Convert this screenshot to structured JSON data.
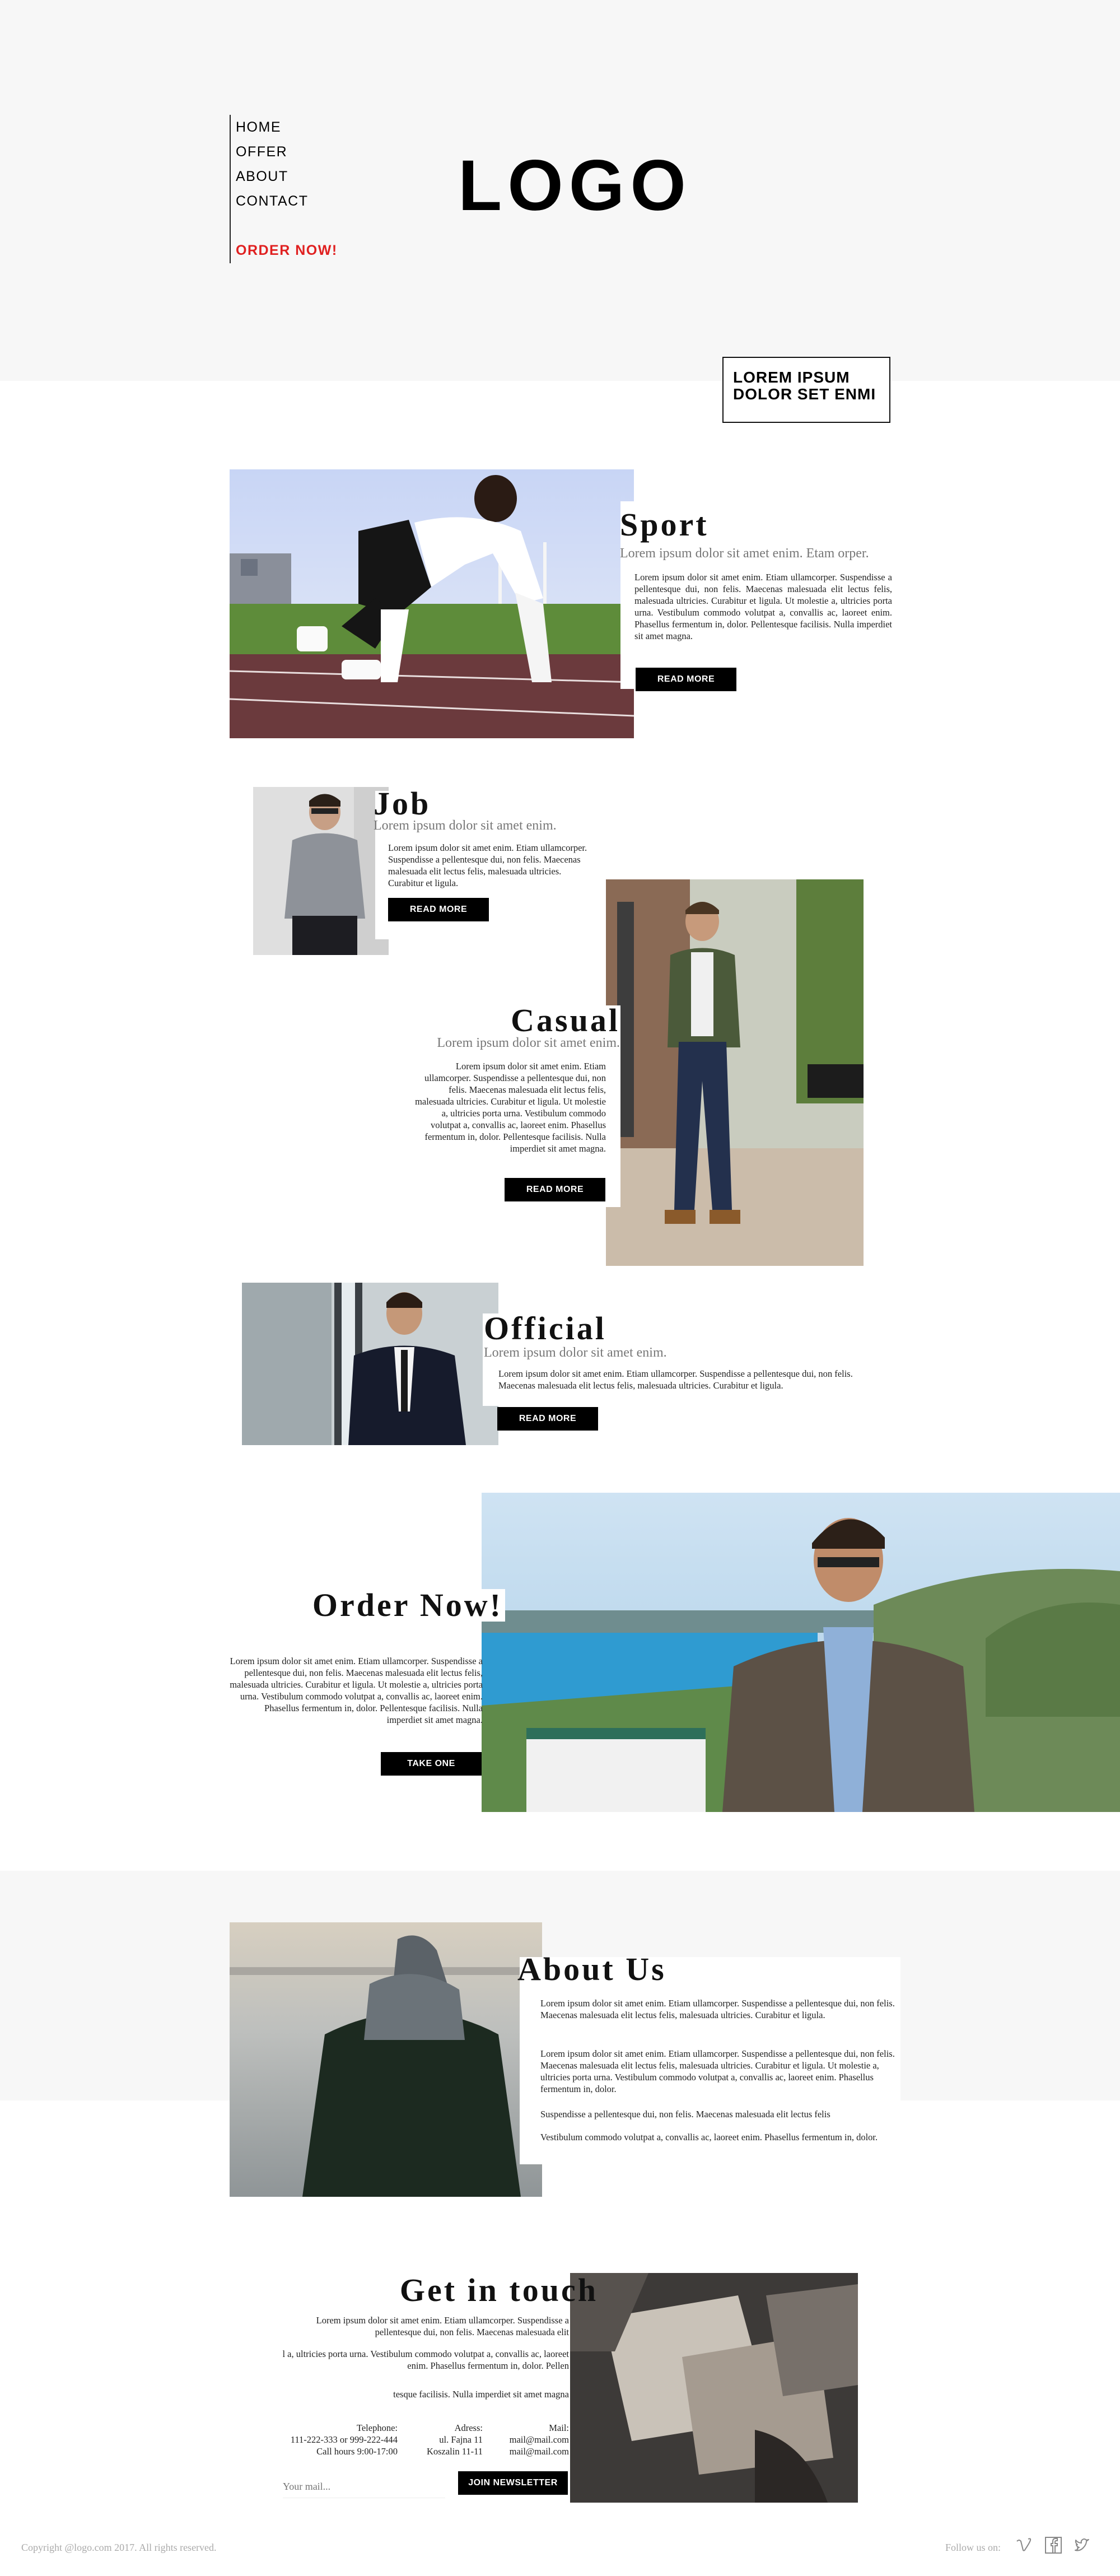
{
  "nav": {
    "items": [
      "HOME",
      "OFFER",
      "ABOUT",
      "CONTACT"
    ],
    "order": "ORDER NOW!"
  },
  "logo": "LOGO",
  "tagline": {
    "line1": "LOREM IPSUM",
    "line2": "DOLOR SET ENMI"
  },
  "sections": {
    "sport": {
      "title": "Sport",
      "subtitle": "Lorem ipsum dolor sit amet enim. Etam orper.",
      "body": "Lorem ipsum dolor sit amet enim. Etiam ullamcorper. Suspendisse a pellentesque dui, non felis. Maecenas malesuada elit lectus felis, malesuada ultricies. Curabitur et ligula. Ut molestie a, ultricies porta urna. Vestibulum commodo volutpat a, convallis ac, laoreet enim. Phasellus fermentum in, dolor. Pellentesque facilisis. Nulla imperdiet sit amet magna.",
      "button": "READ MORE"
    },
    "job": {
      "title": "Job",
      "subtitle": "Lorem ipsum dolor sit amet enim.",
      "body": "Lorem ipsum dolor sit amet enim. Etiam ullamcorper. Suspendisse a pellentesque dui, non felis. Maecenas malesuada elit lectus felis, malesuada ultricies. Curabitur et ligula.",
      "button": "READ MORE"
    },
    "casual": {
      "title": "Casual",
      "subtitle": "Lorem ipsum dolor sit amet enim.",
      "body": "Lorem ipsum dolor sit amet enim. Etiam ullamcorper. Suspendisse a pellentesque dui, non felis. Maecenas malesuada elit lectus felis, malesuada ultricies. Curabitur et ligula. Ut molestie a, ultricies porta urna. Vestibulum commodo volutpat a, convallis ac, laoreet enim. Phasellus fermentum in, dolor. Pellentesque facilisis. Nulla imperdiet sit amet magna.",
      "button": "READ MORE"
    },
    "official": {
      "title": "Official",
      "subtitle": "Lorem ipsum dolor sit amet enim.",
      "body": "Lorem ipsum dolor sit amet enim. Etiam ullamcorper. Suspendisse a pellentesque dui, non felis. Maecenas malesuada elit lectus felis, malesuada ultricies. Curabitur et ligula.",
      "button": "READ MORE"
    },
    "order": {
      "title": "Order Now!",
      "body": "Lorem ipsum dolor sit amet enim. Etiam ullamcorper. Suspendisse a pellentesque dui, non felis. Maecenas malesuada elit lectus felis, malesuada ultricies. Curabitur et ligula. Ut molestie a, ultricies porta urna. Vestibulum commodo volutpat a, convallis ac, laoreet enim. Phasellus fermentum in, dolor. Pellentesque facilisis. Nulla imperdiet sit amet magna.",
      "button": "TAKE ONE"
    },
    "about": {
      "title": "About Us",
      "p1": "Lorem ipsum dolor sit amet enim. Etiam ullamcorper. Suspendisse a pellentesque dui, non felis. Maecenas malesuada elit lectus felis, malesuada ultricies. Curabitur et ligula.",
      "p2": "Lorem ipsum dolor sit amet enim. Etiam ullamcorper. Suspendisse a pellentesque dui, non felis. Maecenas malesuada elit lectus felis, malesuada ultricies. Curabitur et ligula. Ut molestie a, ultricies porta urna. Vestibulum commodo volutpat a, convallis ac, laoreet enim. Phasellus fermentum in, dolor.",
      "p3": "Suspendisse a pellentesque dui, non felis. Maecenas malesuada elit lectus felis",
      "p4": "Vestibulum commodo volutpat a, convallis ac, laoreet enim. Phasellus fermentum in, dolor."
    },
    "contact": {
      "title": "Get in touch",
      "p1": "Lorem ipsum dolor sit amet enim. Etiam ullamcorper. Suspendisse a pellentesque dui, non felis. Maecenas malesuada elit",
      "p2": "l a, ultricies porta urna. Vestibulum commodo volutpat a, convallis ac, laoreet enim. Phasellus fermentum in, dolor. Pellen",
      "p3": "tesque facilisis. Nulla imperdiet sit amet magna",
      "telephone_label": "Telephone:",
      "telephone_value": "111-222-333 or 999-222-444",
      "hours": "Call hours 9:00-17:00",
      "address_label": "Adress:",
      "address_line1": "ul. Fajna 11",
      "address_line2": "Koszalin 11-11",
      "mail_label": "Mail:",
      "mail_line1": "mail@mail.com",
      "mail_line2": "mail@mail.com",
      "newsletter_placeholder": "Your mail...",
      "newsletter_button": "JOIN NEWSLETTER"
    }
  },
  "footer": {
    "copyright": "Copyright @logo.com 2017. All rights reserved.",
    "follow": "Follow us on:",
    "social_icons": [
      "vimeo-icon",
      "facebook-icon",
      "twitter-icon"
    ]
  },
  "colors": {
    "accent": "#e02020",
    "text": "#111111",
    "panel": "#f7f7f7",
    "button": "#000000"
  }
}
